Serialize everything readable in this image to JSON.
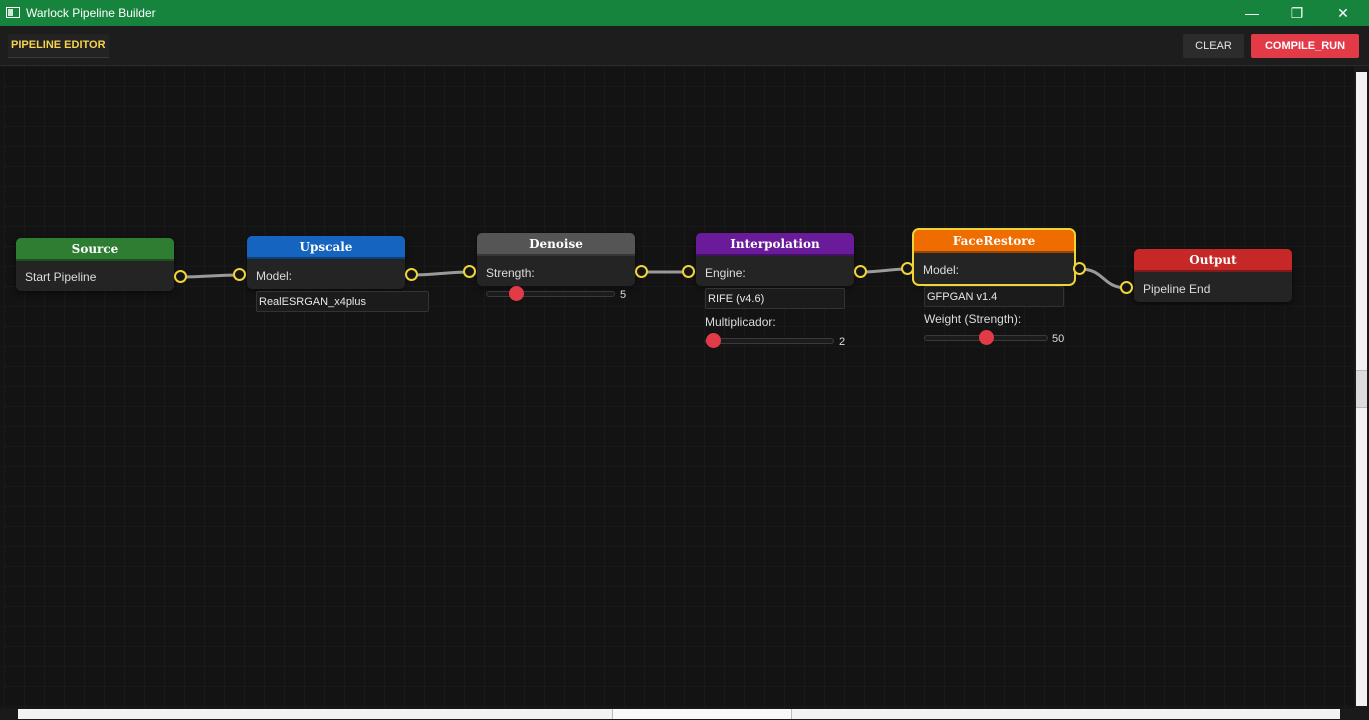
{
  "window": {
    "title": "Warlock Pipeline Builder",
    "minimize": "—",
    "maximize": "❐",
    "close": "✕"
  },
  "toolbar": {
    "tab_label": "PIPELINE EDITOR",
    "clear_label": "CLEAR",
    "run_label": "COMPILE_RUN"
  },
  "colors": {
    "accent": "#f1d437",
    "run": "#e33a48",
    "titlebar": "#17843e"
  },
  "nodes": {
    "source": {
      "title": "Source",
      "color": "#2e7d32",
      "label": "Start Pipeline"
    },
    "upscale": {
      "title": "Upscale",
      "color": "#1565c0",
      "model_label": "Model:",
      "model_value": "RealESRGAN_x4plus"
    },
    "denoise": {
      "title": "Denoise",
      "color": "#555555",
      "strength_label": "Strength:",
      "strength_value": "5",
      "strength_fraction": 0.2
    },
    "interpolation": {
      "title": "Interpolation",
      "color": "#6a1b9a",
      "engine_label": "Engine:",
      "engine_value": "RIFE (v4.6)",
      "mult_label": "Multiplicador:",
      "mult_value": "2",
      "mult_fraction": 0.0
    },
    "facerestore": {
      "title": "FaceRestore",
      "color": "#ef6c00",
      "model_label": "Model:",
      "model_value": "GFPGAN v1.4",
      "weight_label": "Weight (Strength):",
      "weight_value": "50",
      "weight_fraction": 0.5
    },
    "output": {
      "title": "Output",
      "color": "#c62828",
      "label": "Pipeline End"
    }
  }
}
